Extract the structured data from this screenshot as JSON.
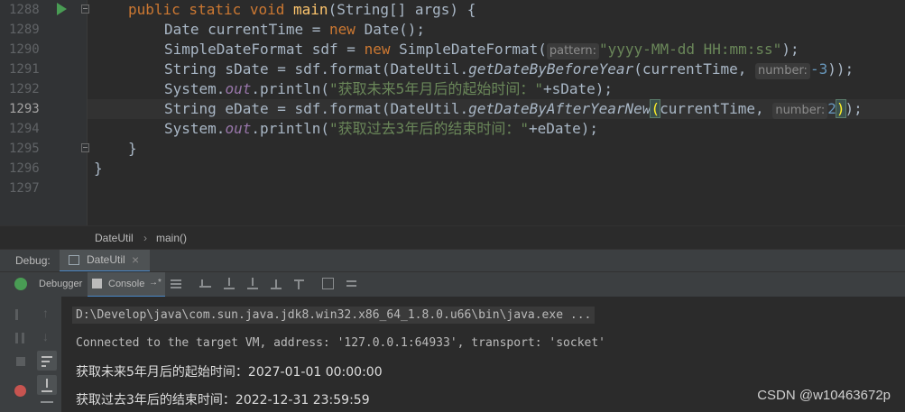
{
  "editor": {
    "gutter_lines": [
      "1288",
      "1289",
      "1290",
      "1291",
      "1292",
      "1293",
      "1294",
      "1295",
      "1296",
      "1297"
    ],
    "current_line": "1293",
    "code": {
      "l1288": {
        "kw1": "public static void ",
        "fn": "main",
        "rest": "(String[] args) {"
      },
      "l1289": {
        "a": "Date currentTime = ",
        "kw": "new ",
        "b": "Date();"
      },
      "l1290": {
        "a": "SimpleDateFormat sdf = ",
        "kw": "new ",
        "b": "SimpleDateFormat(",
        "hint": "pattern:",
        "str": "\"yyyy-MM-dd HH:mm:ss\"",
        "c": ");"
      },
      "l1291": {
        "a": "String sDate = sdf.format(DateUtil.",
        "m": "getDateByBeforeYear",
        "b": "(currentTime, ",
        "hint": "number:",
        "num": "-3",
        "c": "));"
      },
      "l1292": {
        "a": "System.",
        "st": "out",
        "b": ".println(",
        "str": "\"获取未来5年月后的起始时间：\"",
        "c": "+sDate);"
      },
      "l1293": {
        "a": "String eDate = sdf.format(DateUtil.",
        "m": "getDateByAfterYearNew",
        "paren": "(",
        "b": "currentTime, ",
        "hint": "number:",
        "num": "2",
        "paren2": ")",
        "c": ");"
      },
      "l1294": {
        "a": "System.",
        "st": "out",
        "b": ".println(",
        "str": "\"获取过去3年后的结束时间：\"",
        "c": "+eDate);"
      },
      "l1295": {
        "a": "}"
      },
      "l1296": {
        "a": "}"
      }
    }
  },
  "breadcrumb": {
    "class": "DateUtil",
    "sep": "›",
    "method": "main()"
  },
  "debug": {
    "label": "Debug:",
    "session_tab": "DateUtil",
    "close": "×",
    "tabs": {
      "debugger": "Debugger",
      "console": "Console",
      "pin": "→*"
    }
  },
  "console": {
    "cmd": "D:\\Develop\\java\\com.sun.java.jdk8.win32.x86_64_1.8.0.u66\\bin\\java.exe ...",
    "connected": "Connected to the target VM, address: '127.0.0.1:64933', transport: 'socket'",
    "out1": "获取未来5年月后的起始时间：2027-01-01 00:00:00",
    "out2": "获取过去3年后的结束时间：2022-12-31 23:59:59"
  },
  "watermark": "CSDN @w10463672p",
  "colors": {
    "keyword": "#cc7832",
    "method": "#ffc66d",
    "string": "#6a8759",
    "number": "#6897bb",
    "static_field": "#9876aa",
    "run_icon": "#499c54",
    "debug_icon": "#499c54"
  }
}
